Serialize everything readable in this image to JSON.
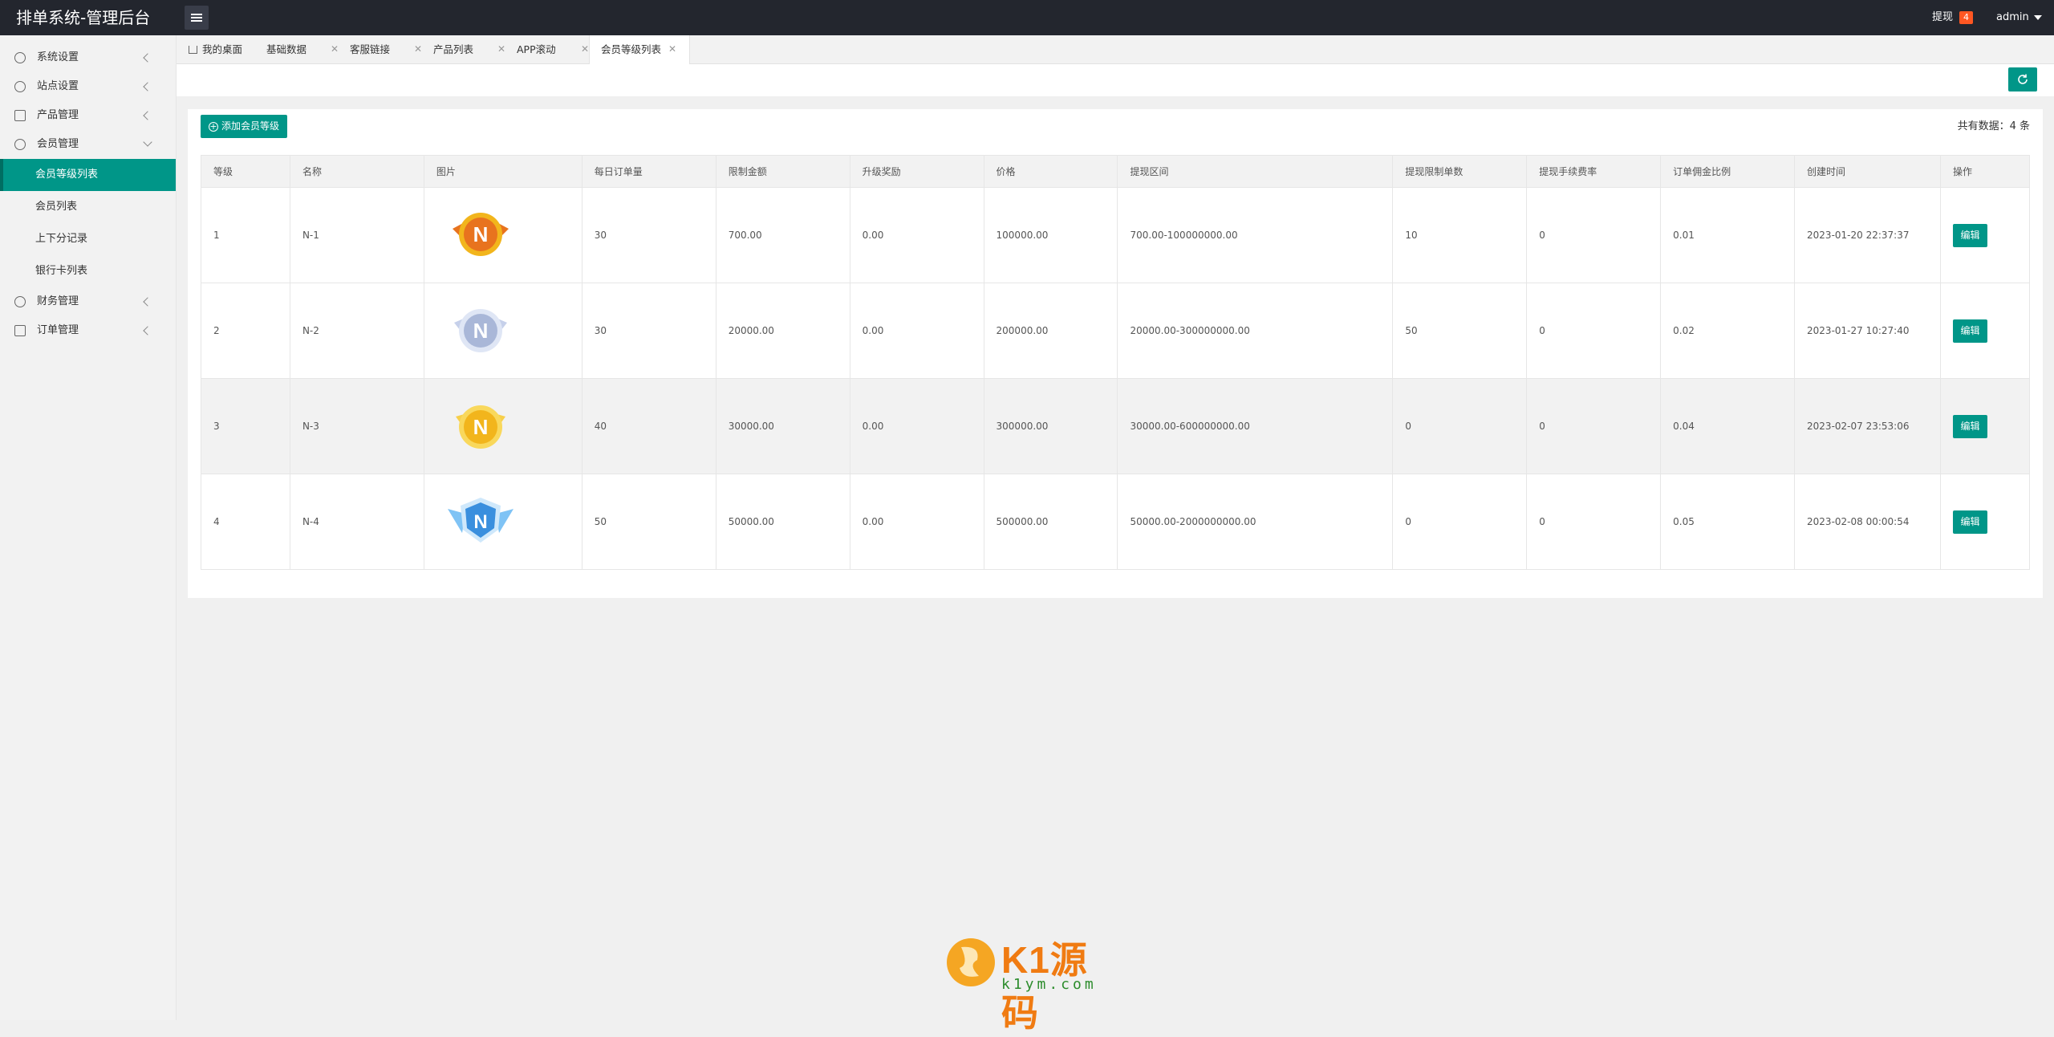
{
  "header": {
    "title": "排单系统-管理后台",
    "withdraw_label": "提现",
    "withdraw_count": "4",
    "user": "admin"
  },
  "sidebar": {
    "items": [
      {
        "label": "系统设置",
        "icon": "gear-icon"
      },
      {
        "label": "站点设置",
        "icon": "refresh-icon"
      },
      {
        "label": "产品管理",
        "icon": "layers-icon"
      },
      {
        "label": "会员管理",
        "icon": "user-icon"
      },
      {
        "label": "财务管理",
        "icon": "dollar-icon"
      },
      {
        "label": "订单管理",
        "icon": "layers-icon"
      }
    ],
    "member_subitems": [
      {
        "label": "会员等级列表",
        "active": true
      },
      {
        "label": "会员列表"
      },
      {
        "label": "上下分记录"
      },
      {
        "label": "银行卡列表"
      }
    ]
  },
  "tabs": [
    {
      "label": "我的桌面"
    },
    {
      "label": "基础数据"
    },
    {
      "label": "客服链接"
    },
    {
      "label": "产品列表"
    },
    {
      "label": "APP滚动"
    },
    {
      "label": "会员等级列表",
      "active": true
    }
  ],
  "toolbar": {
    "add_label": "添加会员等级",
    "total_text": "共有数据：4 条"
  },
  "table": {
    "columns": [
      "等级",
      "名称",
      "图片",
      "每日订单量",
      "限制金额",
      "升级奖励",
      "价格",
      "提现区间",
      "提现限制单数",
      "提现手续费率",
      "订单佣金比例",
      "创建时间",
      "操作"
    ],
    "rows": [
      {
        "level": "1",
        "name": "N-1",
        "daily": "30",
        "limit": "700.00",
        "reward": "0.00",
        "price": "100000.00",
        "range": "700.00-100000000.00",
        "wcount": "10",
        "fee": "0",
        "commission": "0.01",
        "created": "2023-01-20 22:37:37",
        "action": "编辑",
        "badge_color": "#e8731e"
      },
      {
        "level": "2",
        "name": "N-2",
        "daily": "30",
        "limit": "20000.00",
        "reward": "0.00",
        "price": "200000.00",
        "range": "20000.00-300000000.00",
        "wcount": "50",
        "fee": "0",
        "commission": "0.02",
        "created": "2023-01-27 10:27:40",
        "action": "编辑",
        "badge_color": "#a9b7d8"
      },
      {
        "level": "3",
        "name": "N-3",
        "daily": "40",
        "limit": "30000.00",
        "reward": "0.00",
        "price": "300000.00",
        "range": "30000.00-600000000.00",
        "wcount": "0",
        "fee": "0",
        "commission": "0.04",
        "created": "2023-02-07 23:53:06",
        "action": "编辑",
        "badge_color": "#f2b51c"
      },
      {
        "level": "4",
        "name": "N-4",
        "daily": "50",
        "limit": "50000.00",
        "reward": "0.00",
        "price": "500000.00",
        "range": "50000.00-2000000000.00",
        "wcount": "0",
        "fee": "0",
        "commission": "0.05",
        "created": "2023-02-08 00:00:54",
        "action": "编辑",
        "badge_color": "#3a8fde"
      }
    ]
  },
  "watermark": {
    "brand": "K1源码",
    "domain": "k1ym.com"
  },
  "colors": {
    "accent": "#009688",
    "topbar": "#23262e",
    "badge": "#ff5722"
  }
}
